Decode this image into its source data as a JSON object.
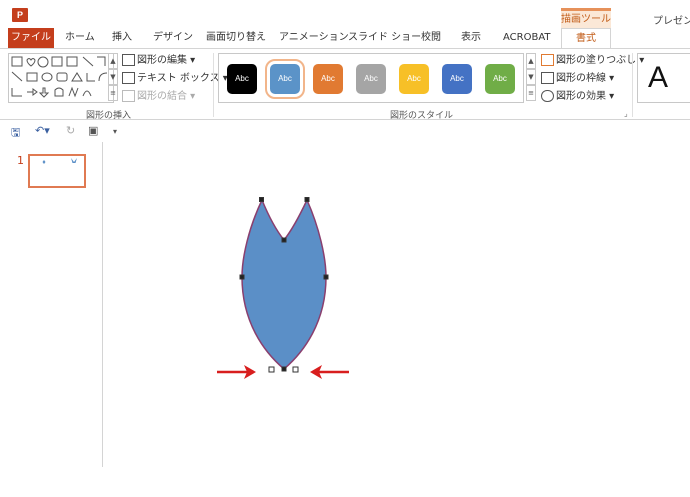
{
  "app": {
    "icon_letter": "P",
    "window_title": "プレゼンテ",
    "context_tab_header": "描画ツール"
  },
  "tabs": [
    "ファイル",
    "ホーム",
    "挿入",
    "デザイン",
    "画面切り替え",
    "アニメーション",
    "スライド ショー",
    "校閲",
    "表示",
    "ACROBAT",
    "書式"
  ],
  "active_tab": "書式",
  "ribbon": {
    "insert_shapes": {
      "label": "図形の挿入",
      "edit_shape": "図形の編集",
      "text_box": "テキスト ボックス",
      "merge_shapes": "図形の結合"
    },
    "shape_styles": {
      "label": "図形のスタイル",
      "swatch_text": "Abc",
      "swatch_colors": [
        "#000000",
        "#5b93c8",
        "#e17a32",
        "#a5a5a5",
        "#f7c027",
        "#4472c4",
        "#70ad47"
      ],
      "selected_index": 1,
      "fill": "図形の塗りつぶし",
      "outline": "図形の枠線",
      "effects": "図形の効果"
    },
    "wordart_letter": "A"
  },
  "thumbnails": {
    "slide_number": "1"
  },
  "colors": {
    "accent": "#c43e1c",
    "shape_fill": "#5b8fc7",
    "shape_outline": "#8a3f6e",
    "arrow": "#d81e1e"
  }
}
